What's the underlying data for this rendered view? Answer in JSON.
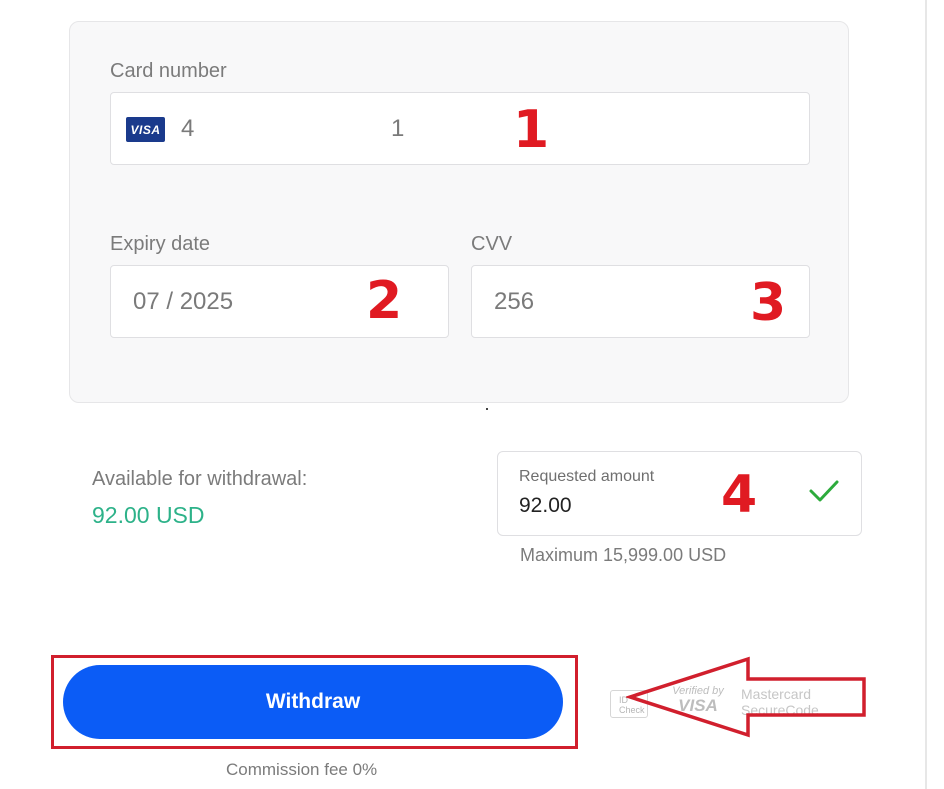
{
  "card_form": {
    "card_number": {
      "label": "Card number",
      "brand": "VISA",
      "prefix": "4",
      "suffix": "1"
    },
    "expiry": {
      "label": "Expiry date",
      "value": "07 / 2025"
    },
    "cvv": {
      "label": "CVV",
      "value": "256"
    }
  },
  "annotations": {
    "step1": "1",
    "step2": "2",
    "step3": "3",
    "step4": "4",
    "highlight_color": "#d11f2d",
    "number_color": "#e01a22"
  },
  "withdrawal": {
    "available_label": "Available for withdrawal:",
    "available_value": "92.00 USD",
    "requested_label": "Requested amount",
    "requested_value": "92.00",
    "max_text": "Maximum 15,999.00 USD",
    "valid_icon": "check-icon"
  },
  "actions": {
    "withdraw_label": "Withdraw",
    "fee_text": "Commission fee 0%"
  },
  "security_badges": {
    "badge1": "ID Check secured",
    "verified_line1": "Verified by",
    "verified_line2": "VISA",
    "mc_line1": "Mastercard",
    "mc_line2": "SecureCode"
  },
  "colors": {
    "button": "#0b5cf6",
    "available_value": "#2db289",
    "check": "#2dab3c"
  }
}
